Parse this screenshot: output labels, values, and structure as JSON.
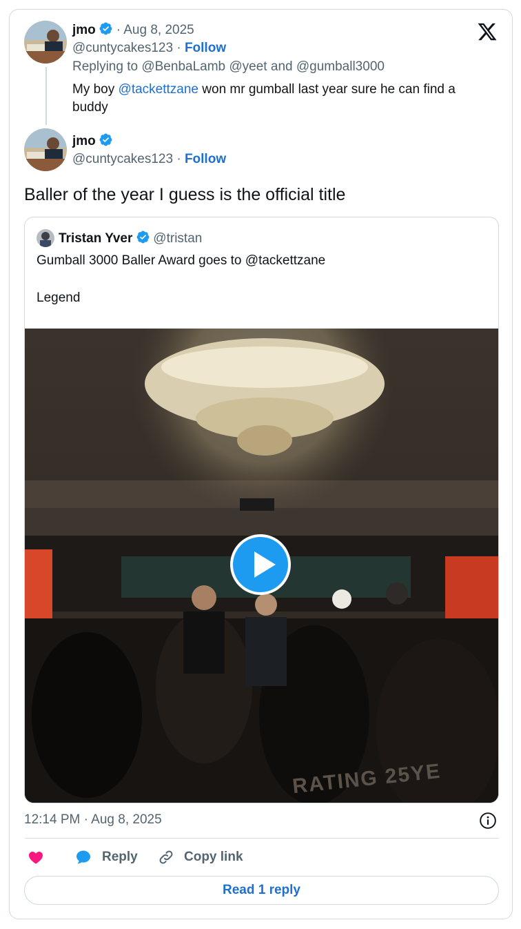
{
  "reply_tweet": {
    "author_name": "jmo",
    "date": "Aug 8, 2025",
    "handle": "@cuntycakes123",
    "follow_label": "Follow",
    "replying_prefix": "Replying to",
    "replying_to_1": "@BenbaLamb",
    "replying_to_2": "@yeet",
    "replying_and": "and",
    "replying_to_3": "@gumball3000",
    "text_before": "My boy",
    "mention": "@tackettzane",
    "text_after": "won mr gumball last year sure he can find a",
    "text_line2": "buddy"
  },
  "main_tweet": {
    "author_name": "jmo",
    "handle": "@cuntycakes123",
    "follow_label": "Follow",
    "text": "Baller of the year I guess is the official title"
  },
  "quoted_tweet": {
    "author_name": "Tristan Yver",
    "handle": "@tristan",
    "line1": "Gumball 3000 Baller Award goes to @tackettzane",
    "line2": "Legend",
    "video_overlay_text": "RATING 25YE"
  },
  "footer": {
    "timestamp": "12:14 PM · Aug 8, 2025",
    "reply_label": "Reply",
    "copy_link_label": "Copy link",
    "read_replies_label": "Read 1 reply"
  },
  "icons": {
    "x_logo": "x-logo-icon",
    "verified": "verified-badge-icon",
    "info": "info-icon",
    "heart": "heart-icon",
    "reply": "reply-bubble-icon",
    "link": "link-icon",
    "play": "play-icon"
  },
  "colors": {
    "accent": "#1d9bf0",
    "link": "#1d6fd0",
    "muted": "#536471",
    "heart": "#f91880",
    "border": "#cfd9de"
  }
}
